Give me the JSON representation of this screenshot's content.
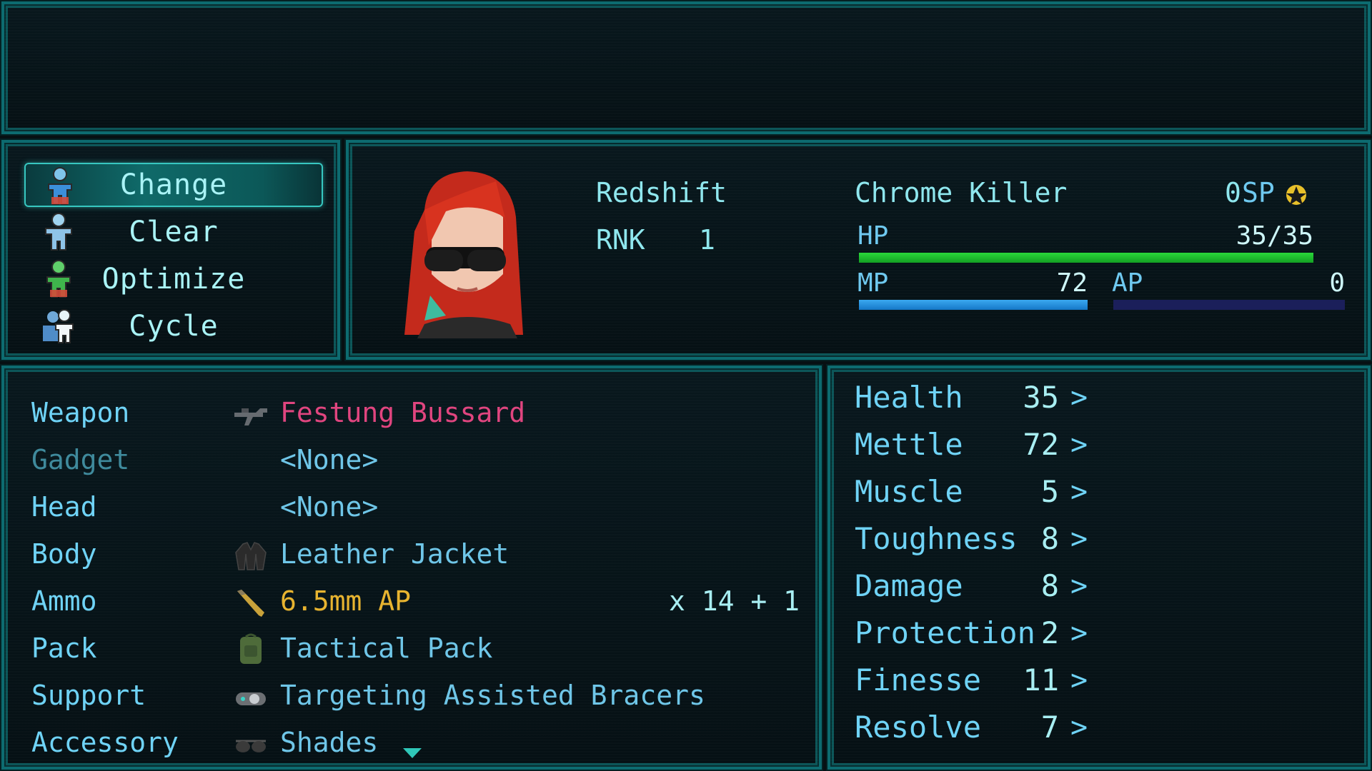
{
  "help": {
    "text": ""
  },
  "commands": [
    {
      "label": "Change",
      "icon": "figure-change-icon",
      "selected": true
    },
    {
      "label": "Clear",
      "icon": "figure-clear-icon",
      "selected": false
    },
    {
      "label": "Optimize",
      "icon": "figure-optimize-icon",
      "selected": false
    },
    {
      "label": "Cycle",
      "icon": "figure-cycle-icon",
      "selected": false
    }
  ],
  "actor": {
    "name": "Redshift",
    "rank_label": "RNK",
    "rank": "1",
    "class": "Chrome Killer",
    "sp": "0",
    "sp_label": "SP",
    "hp_label": "HP",
    "hp_text": "35/35",
    "hp_fraction": 1.0,
    "mp_label": "MP",
    "mp_text": "72",
    "mp_fraction": 1.0,
    "ap_label": "AP",
    "ap_text": "0",
    "ap_fraction": 0.0
  },
  "equipment": [
    {
      "slot": "Weapon",
      "item": "Festung Bussard",
      "icon": "rifle-icon",
      "color": "#e0457f",
      "dim": false
    },
    {
      "slot": "Gadget",
      "item": "<None>",
      "icon": "",
      "color": "#6fc6e8",
      "dim": true
    },
    {
      "slot": "Head",
      "item": "<None>",
      "icon": "",
      "color": "#6fc6e8",
      "dim": false
    },
    {
      "slot": "Body",
      "item": "Leather Jacket",
      "icon": "jacket-icon",
      "color": "#6fc6e8",
      "dim": false
    },
    {
      "slot": "Ammo",
      "item": "6.5mm AP",
      "icon": "bullet-icon",
      "color": "#e8b430",
      "dim": false,
      "qty": "x 14 + 1"
    },
    {
      "slot": "Pack",
      "item": "Tactical Pack",
      "icon": "backpack-icon",
      "color": "#6fc6e8",
      "dim": false
    },
    {
      "slot": "Support",
      "item": "Targeting Assisted Bracers",
      "icon": "bracer-icon",
      "color": "#6fc6e8",
      "dim": false
    },
    {
      "slot": "Accessory",
      "item": "Shades",
      "icon": "shades-icon",
      "color": "#6fc6e8",
      "dim": false
    }
  ],
  "params": [
    {
      "name": "Health",
      "value": "35",
      "arrow": ">"
    },
    {
      "name": "Mettle",
      "value": "72",
      "arrow": ">"
    },
    {
      "name": "Muscle",
      "value": "5",
      "arrow": ">"
    },
    {
      "name": "Toughness",
      "value": "8",
      "arrow": ">"
    },
    {
      "name": "Damage",
      "value": "8",
      "arrow": ">"
    },
    {
      "name": "Protection",
      "value": "2",
      "arrow": ">"
    },
    {
      "name": "Finesse",
      "value": "11",
      "arrow": ">"
    },
    {
      "name": "Resolve",
      "value": "7",
      "arrow": ">"
    }
  ],
  "colors": {
    "frame": "#0d6b70",
    "hp_gauge": "#1dbf2a",
    "mp_gauge": "#1f8fe0",
    "ap_gauge_bg": "#1b1f5a"
  }
}
